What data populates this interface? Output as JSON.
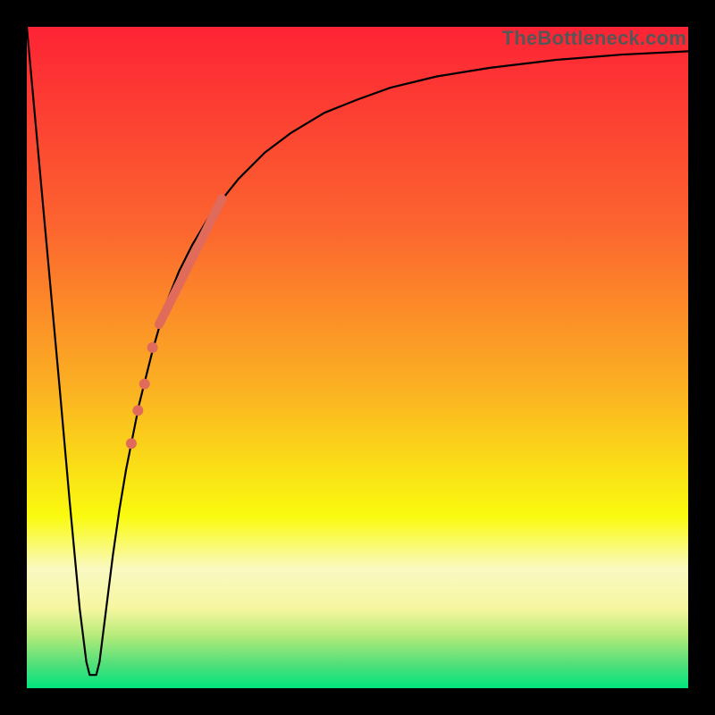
{
  "watermark": "TheBottleneck.com",
  "chart_data": {
    "type": "line",
    "title": "",
    "xlabel": "",
    "ylabel": "",
    "xlim": [
      0,
      100
    ],
    "ylim": [
      0,
      100
    ],
    "grid": false,
    "legend": false,
    "series": [
      {
        "name": "curve",
        "type": "line",
        "color": "#000000",
        "x": [
          0,
          3,
          5,
          6.5,
          8,
          9,
          9.5,
          10.5,
          11,
          12,
          13,
          14,
          15,
          17,
          19,
          21,
          23,
          25,
          28,
          32,
          36,
          40,
          45,
          50,
          55,
          62,
          70,
          80,
          90,
          100
        ],
        "y": [
          100,
          67,
          45,
          28,
          12,
          4,
          2,
          2,
          4,
          12,
          20,
          27,
          33,
          43,
          51,
          58,
          63,
          67,
          72,
          77,
          81,
          84,
          87,
          89,
          90.8,
          92.5,
          93.8,
          95,
          95.8,
          96.3
        ]
      },
      {
        "name": "highlight-segment",
        "type": "line",
        "color": "#e06b5b",
        "stroke_width": 10,
        "x": [
          20.0,
          29.5
        ],
        "y": [
          55.0,
          74.0
        ]
      },
      {
        "name": "highlight-dots",
        "type": "scatter",
        "color": "#e06b5b",
        "marker_radius": 6,
        "x": [
          19.0,
          17.8,
          16.8,
          15.8
        ],
        "y": [
          51.5,
          46.0,
          42.0,
          37.0
        ]
      }
    ],
    "background": {
      "type": "vertical_gradient",
      "stops": [
        {
          "offset": 0.0,
          "color": "#fd2335"
        },
        {
          "offset": 0.3,
          "color": "#fc642f"
        },
        {
          "offset": 0.55,
          "color": "#fbb222"
        },
        {
          "offset": 0.74,
          "color": "#fafa0f"
        },
        {
          "offset": 0.82,
          "color": "#f9f9c2"
        },
        {
          "offset": 0.88,
          "color": "#f6f6a0"
        },
        {
          "offset": 0.92,
          "color": "#b6eb7a"
        },
        {
          "offset": 0.965,
          "color": "#4fdf7a"
        },
        {
          "offset": 1.0,
          "color": "#00e57d"
        }
      ]
    }
  }
}
